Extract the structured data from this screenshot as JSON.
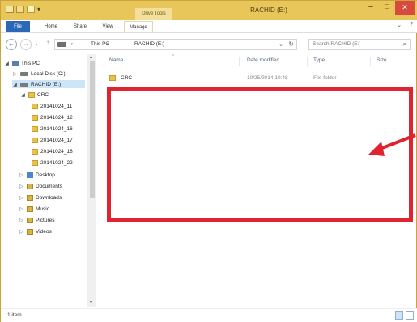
{
  "window": {
    "title": "RACHID (E:)",
    "contextual_tab": "Drive Tools",
    "controls": {
      "minimize": "–",
      "maximize": "□",
      "close": "✕"
    }
  },
  "ribbon": {
    "tabs": [
      {
        "label": "File"
      },
      {
        "label": "Home"
      },
      {
        "label": "Share"
      },
      {
        "label": "View"
      },
      {
        "label": "Manage"
      }
    ]
  },
  "address": {
    "back_glyph": "←",
    "forward_glyph": "→",
    "up_glyph": "↑",
    "breadcrumb": [
      "›",
      "This PC",
      "›",
      "RACHID (E:)"
    ],
    "search_placeholder": "Search RACHID (E:)"
  },
  "nav_tree": [
    {
      "label": "This PC",
      "twisty": "◢",
      "icon": "computer-icon"
    },
    {
      "label": "Local Disk (C:)",
      "twisty": "▷",
      "icon": "drive-icon"
    },
    {
      "label": "RACHID (E:)",
      "twisty": "◢",
      "icon": "drive-icon"
    },
    {
      "label": "CRC",
      "twisty": "◢",
      "icon": "folder-icon"
    },
    {
      "label": "20141024_11",
      "twisty": "",
      "icon": "folder-icon"
    },
    {
      "label": "20141024_12",
      "twisty": "",
      "icon": "folder-icon"
    },
    {
      "label": "20141024_16",
      "twisty": "",
      "icon": "folder-icon"
    },
    {
      "label": "20141024_17",
      "twisty": "",
      "icon": "folder-icon"
    },
    {
      "label": "20141024_18",
      "twisty": "",
      "icon": "folder-icon"
    },
    {
      "label": "20141024_22",
      "twisty": "",
      "icon": "folder-icon"
    },
    {
      "label": "Desktop",
      "twisty": "▷",
      "icon": "desktop-icon"
    },
    {
      "label": "Documents",
      "twisty": "▷",
      "icon": "library-icon"
    },
    {
      "label": "Downloads",
      "twisty": "▷",
      "icon": "library-icon"
    },
    {
      "label": "Music",
      "twisty": "▷",
      "icon": "library-icon"
    },
    {
      "label": "Pictures",
      "twisty": "▷",
      "icon": "library-icon"
    },
    {
      "label": "Videos",
      "twisty": "▷",
      "icon": "library-icon"
    }
  ],
  "file_list": {
    "columns": [
      "Name",
      "Date modified",
      "Type",
      "Size"
    ],
    "rows": [
      {
        "name": "CRC",
        "date": "10/25/2014 10:48",
        "type": "File folder",
        "size": ""
      }
    ]
  },
  "status": {
    "item_count": "1 item"
  },
  "colors": {
    "title_bar": "#e8c65a",
    "file_tab": "#2b68b7",
    "annotation": "#e0242f"
  }
}
